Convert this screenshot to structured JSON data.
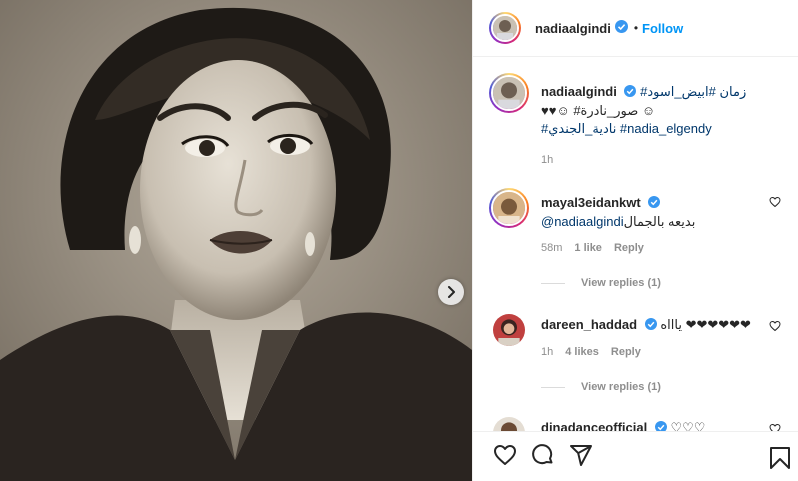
{
  "header": {
    "username": "nadiaalgindi",
    "separator": "•",
    "follow_label": "Follow"
  },
  "caption": {
    "username": "nadiaalgindi",
    "line1": "زمان #ابيض_اسود#",
    "line2": "☺ صور_نادرة# ☺♥♥",
    "line3": "#نادية_الجندي #nadia_elgendy",
    "time": "1h"
  },
  "comments": [
    {
      "username": "mayal3eidankwt",
      "mention": "@nadiaalgindi",
      "text": "بديعه بالجمال",
      "time": "58m",
      "likes": "1 like",
      "reply_label": "Reply",
      "view_replies": "View replies (1)"
    },
    {
      "username": "dareen_haddad",
      "text": "❤❤❤❤❤❤ ياااه",
      "time": "1h",
      "likes": "4 likes",
      "reply_label": "Reply",
      "view_replies": "View replies (1)"
    },
    {
      "username": "dinadanceofficial",
      "text": "♡♡♡"
    }
  ],
  "icons": {
    "like": "heart-icon",
    "comment": "comment-icon",
    "share": "share-icon",
    "save": "bookmark-icon",
    "next": "chevron-right-icon",
    "verified": "verified-badge-icon"
  },
  "colors": {
    "accent": "#0095f6",
    "hashtag": "#00376b",
    "muted": "#8e8e8e",
    "verified": "#3897f0"
  }
}
